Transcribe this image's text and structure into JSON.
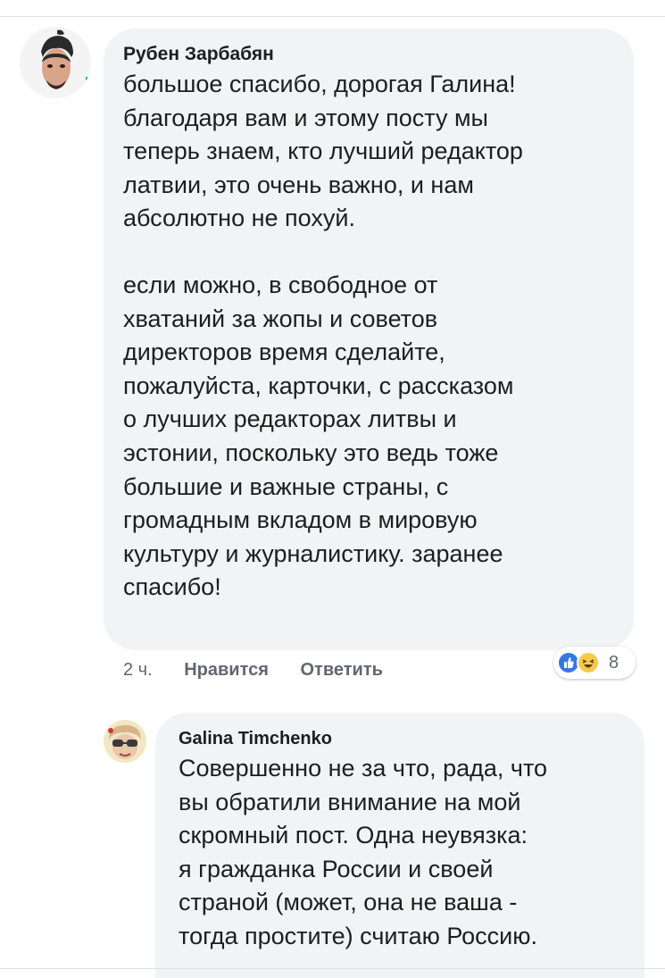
{
  "comment1": {
    "author": "Рубен Зарбабян",
    "paragraph1": [
      "большое спасибо, дорогая Галина!",
      "благодаря вам и этому посту мы",
      "теперь знаем, кто лучший редактор",
      "латвии, это очень важно, и нам",
      "абсолютно не похуй."
    ],
    "paragraph2": [
      "если можно, в свободное от",
      "хватаний за жопы и советов",
      "директоров время сделайте,",
      "пожалуйста, карточки, с рассказом",
      "о лучших редакторах литвы и",
      "эстонии, поскольку это ведь тоже",
      "большие и важные страны, с",
      "громадным вкладом в мировую",
      "культуру и журналистику. заранее",
      "спасибо!"
    ],
    "time": "2 ч.",
    "like_label": "Нравится",
    "reply_label": "Ответить",
    "reactions": {
      "types": [
        "like-icon",
        "haha-icon"
      ],
      "count": "8",
      "colors": {
        "like": "#3578e5",
        "haha": "#f7c94a"
      }
    }
  },
  "comment2": {
    "author": "Galina Timchenko",
    "lines": [
      "Совершенно не за что, рада, что",
      "вы обратили внимание на мой",
      "скромный пост. Одна неувязка:",
      "я гражданка России и своей",
      "страной (может, она не ваша  -",
      "тогда простите) считаю Россию."
    ]
  },
  "colors": {
    "bubble": "#f2f3f5",
    "text": "#1c1e21",
    "meta": "#606770"
  }
}
